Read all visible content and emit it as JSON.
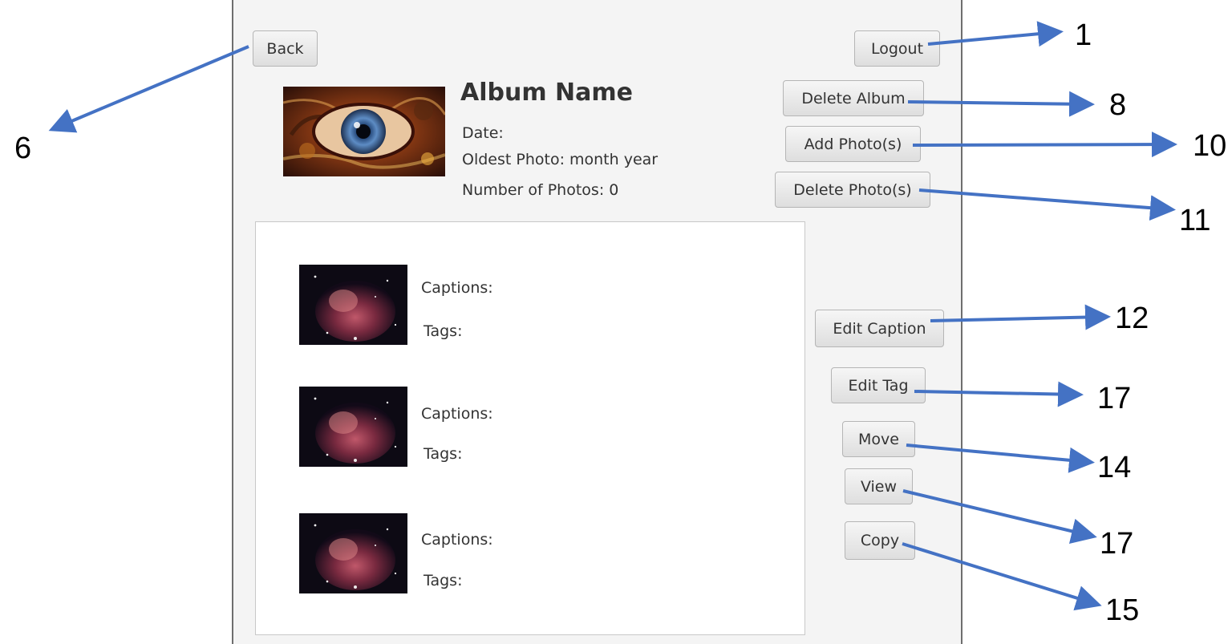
{
  "nav": {
    "back_label": "Back",
    "logout_label": "Logout"
  },
  "album": {
    "title": "Album Name",
    "date": "Date:",
    "oldest": "Oldest Photo: month year",
    "count": "Number of Photos: 0"
  },
  "actions": {
    "delete_album": "Delete Album",
    "add_photos": "Add Photo(s)",
    "delete_photos": "Delete Photo(s)",
    "edit_caption": "Edit Caption",
    "edit_tag": "Edit Tag",
    "move": "Move",
    "view": "View",
    "copy": "Copy"
  },
  "photos": [
    {
      "caption_label": "Captions:",
      "tags_label": "Tags:"
    },
    {
      "caption_label": "Captions:",
      "tags_label": "Tags:"
    },
    {
      "caption_label": "Captions:",
      "tags_label": "Tags:"
    }
  ],
  "callouts": {
    "logout": "1",
    "delete_album": "8",
    "add_photos": "10",
    "delete_photos": "11",
    "edit_caption": "12",
    "edit_tag": "17",
    "move": "14",
    "view": "17",
    "copy": "15",
    "back": "6"
  },
  "colors": {
    "annotation_arrow": "#4472c4",
    "window_bg": "#f4f4f4",
    "list_bg": "#ffffff"
  }
}
